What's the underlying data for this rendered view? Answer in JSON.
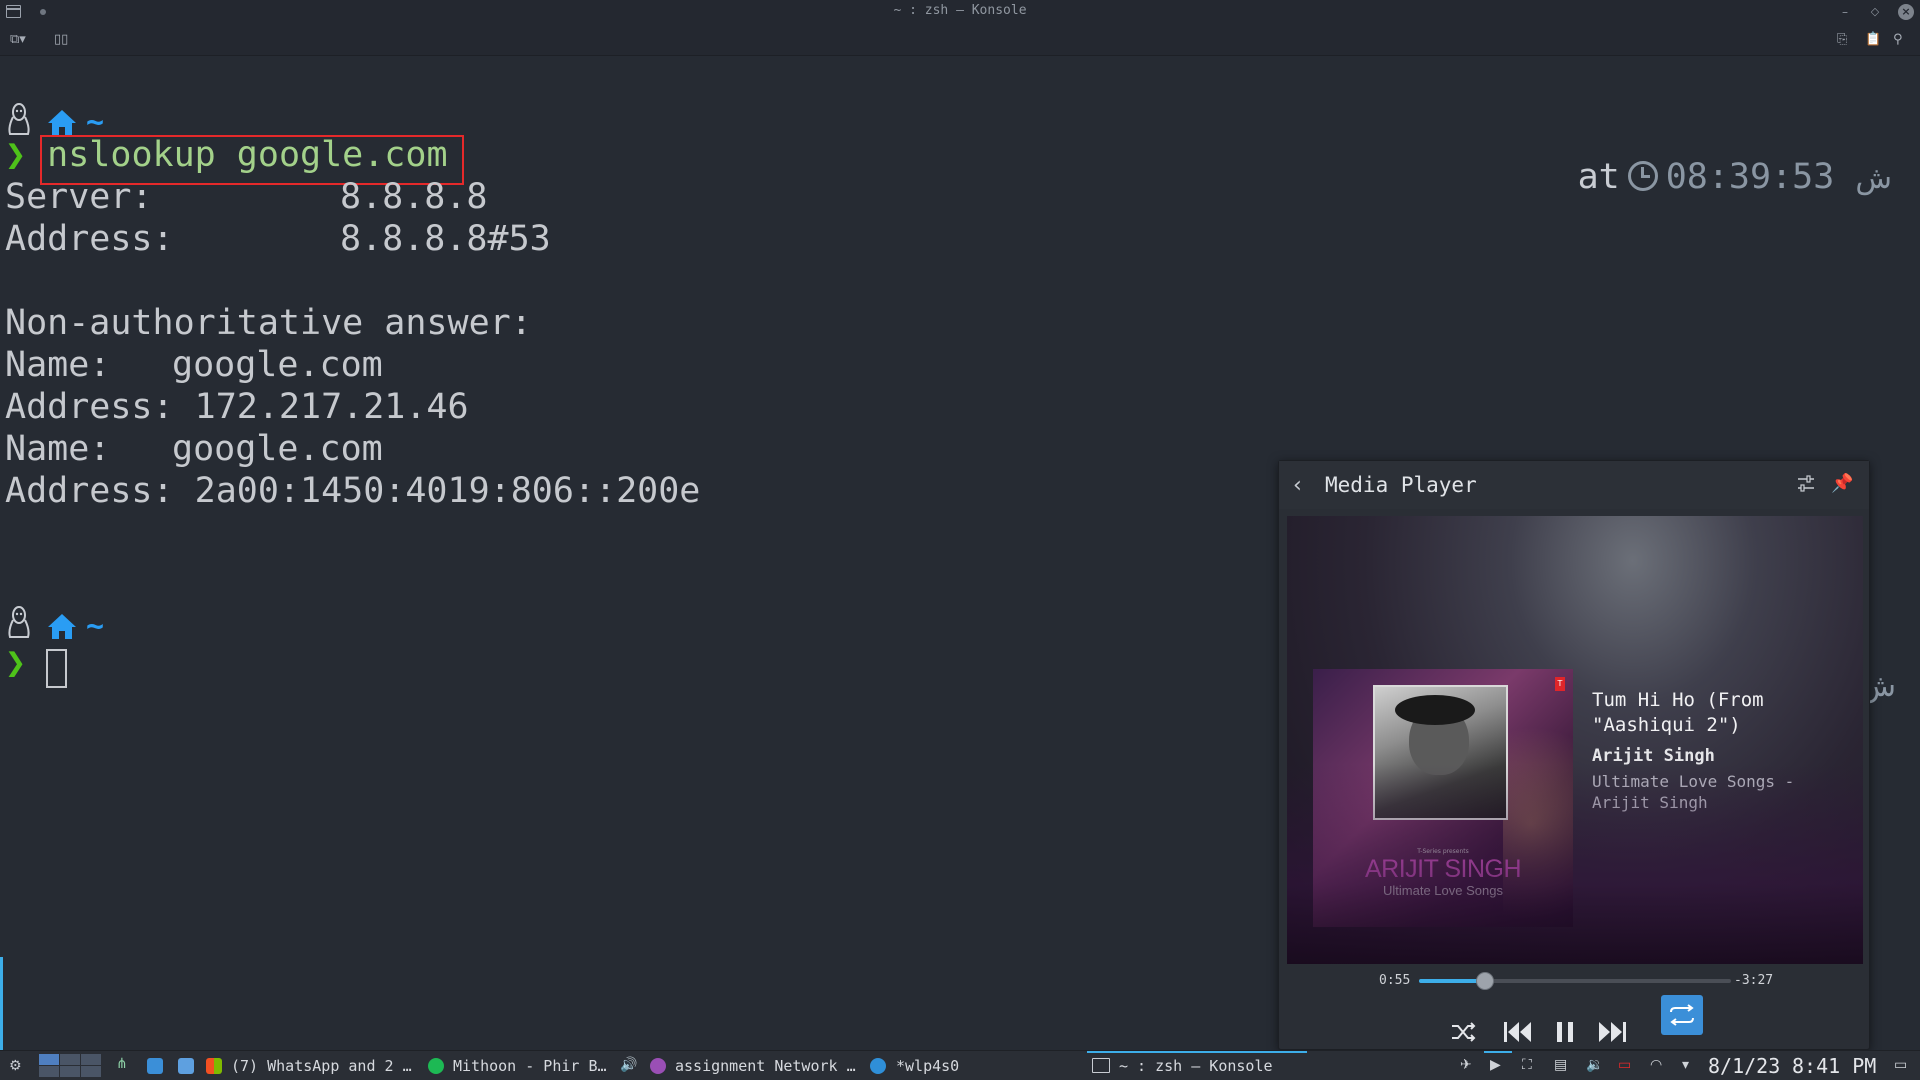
{
  "window": {
    "title": "~ : zsh — Konsole"
  },
  "terminal": {
    "command": "nslookup google.com",
    "output": [
      "Server:\t\t8.8.8.8",
      "Address:\t8.8.8.8#53",
      "",
      "Non-authoritative answer:",
      "Name:\tgoogle.com",
      "Address: 172.217.21.46",
      "Name:\tgoogle.com",
      "Address: 2a00:1450:4019:806::200e"
    ],
    "prompt_dir": "~",
    "right_prompt": {
      "at": "at",
      "time": "08:39:53",
      "suffix": "ش"
    },
    "right_marker": "ش"
  },
  "media_player": {
    "header_title": "Media Player",
    "album_art": {
      "presents": "T-Series presents",
      "artist": "ARIJIT SINGH",
      "subtitle": "Ultimate Love Songs",
      "label_badge": "T"
    },
    "track_title": "Tum Hi Ho (From \"Aashiqui 2\")",
    "artist": "Arijit Singh",
    "album": "Ultimate Love Songs - Arijit Singh",
    "elapsed": "0:55",
    "remaining": "-3:27",
    "progress_fraction": 0.21,
    "accent_color": "#3daee9"
  },
  "taskbar": {
    "tasks": [
      {
        "label": "(7) WhatsApp and 2 …"
      },
      {
        "label": "Mithoon - Phir B…"
      },
      {
        "label": "assignment Network …"
      },
      {
        "label": "*wlp4s0"
      },
      {
        "label": "~ : zsh — Konsole"
      }
    ],
    "date": "8/1/23",
    "time": "8:41 PM"
  }
}
